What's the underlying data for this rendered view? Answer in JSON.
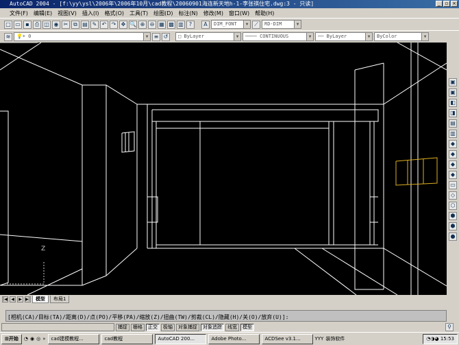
{
  "window": {
    "title": "AutoCAD 2004 - [f:\\yy\\ysl\\2006年\\2006年10月\\cad教程\\20060901海连新天地h-1-李张祺住宅.dwg:3 - 只读]"
  },
  "menu": [
    "文件(F)",
    "编辑(E)",
    "视图(V)",
    "插入(I)",
    "格式(O)",
    "工具(T)",
    "绘图(D)",
    "标注(N)",
    "修改(M)",
    "窗口(W)",
    "帮助(H)"
  ],
  "toolbar": {
    "text_style": "DIM_FONT",
    "dim_style": "RD-DIM",
    "layer": "0",
    "color": "ByLayer",
    "linetype": "CONTINUOUS",
    "lineweight": "ByLayer",
    "plotstyle": "ByColor"
  },
  "tabs": [
    "模型",
    "布局1"
  ],
  "command": {
    "prompt": "[相机(CA)/目标(TA)/距离(D)/点(PO)/平移(PA)/缩放(Z)/扭曲(TW)/剪裁(CL)/隐藏(H)/关(O)/放弃(U)]:"
  },
  "status": {
    "buttons": [
      {
        "label": "捕捉",
        "on": false
      },
      {
        "label": "栅格",
        "on": false
      },
      {
        "label": "正交",
        "on": true
      },
      {
        "label": "极轴",
        "on": false
      },
      {
        "label": "对象捕捉",
        "on": false
      },
      {
        "label": "对象追踪",
        "on": true
      },
      {
        "label": "线宽",
        "on": false
      },
      {
        "label": "模型",
        "on": true
      }
    ]
  },
  "taskbar": {
    "start": "开始",
    "tasks": [
      {
        "label": "cad建模教程...",
        "active": false
      },
      {
        "label": "cad教程",
        "active": false
      },
      {
        "label": "AutoCAD 200...",
        "active": true
      },
      {
        "label": "Adobe Photo...",
        "active": false
      },
      {
        "label": "ACDSee v3.1...",
        "active": false
      }
    ],
    "extra1": "YYY",
    "extra2": "装饰软件",
    "clock": "15:53"
  },
  "colors": {
    "canvas": "#000000",
    "highlight": "#e0b020"
  }
}
